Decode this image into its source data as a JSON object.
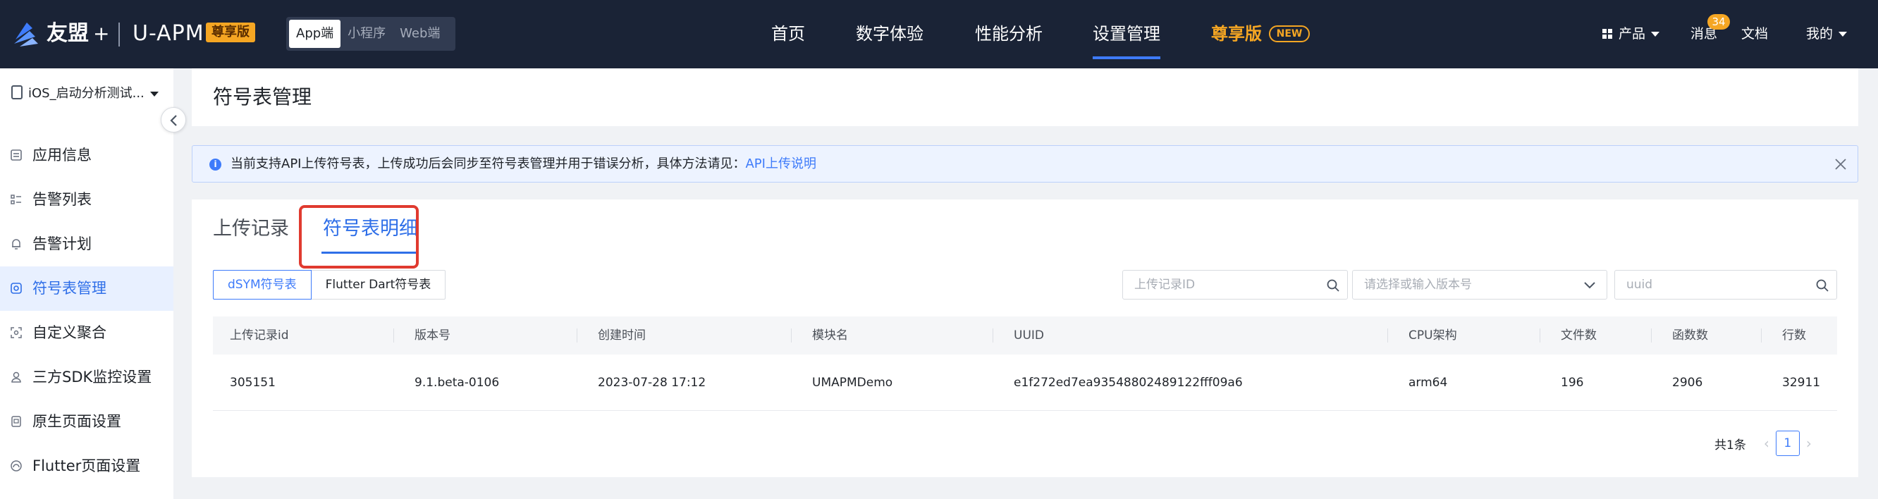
{
  "brand": {
    "name": "友盟",
    "plus": "+",
    "product": "U-APM",
    "edition_badge": "尊享版"
  },
  "platforms": [
    {
      "label": "App端",
      "active": true
    },
    {
      "label": "小程序",
      "active": false
    },
    {
      "label": "Web端",
      "active": false
    }
  ],
  "nav": {
    "items": [
      "首页",
      "数字体验",
      "性能分析",
      "设置管理"
    ],
    "active": "设置管理",
    "vip": "尊享版",
    "new_tag": "NEW"
  },
  "top_right": {
    "products": "产品",
    "messages": "消息",
    "message_count": "34",
    "docs": "文档",
    "mine": "我的"
  },
  "sidebar": {
    "app_name": "iOS_启动分析测试...",
    "items": [
      {
        "label": "应用信息",
        "icon": "file-list-icon"
      },
      {
        "label": "告警列表",
        "icon": "list-icon"
      },
      {
        "label": "告警计划",
        "icon": "bell-icon"
      },
      {
        "label": "符号表管理",
        "icon": "target-icon",
        "active": true
      },
      {
        "label": "自定义聚合",
        "icon": "merge-icon"
      },
      {
        "label": "三方SDK监控设置",
        "icon": "user-icon"
      },
      {
        "label": "原生页面设置",
        "icon": "page-icon"
      },
      {
        "label": "Flutter页面设置",
        "icon": "flutter-icon"
      }
    ]
  },
  "page": {
    "title": "符号表管理"
  },
  "notice": {
    "text": "当前支持API上传符号表，上传成功后会同步至符号表管理并用于错误分析，具体方法请见：",
    "link": "API上传说明"
  },
  "tabs": {
    "upload_records": "上传记录",
    "symbol_details": "符号表明细"
  },
  "segments": {
    "dsym": "dSYM符号表",
    "flutter": "Flutter Dart符号表"
  },
  "filters": {
    "upload_id_placeholder": "上传记录ID",
    "version_placeholder": "请选择或输入版本号",
    "uuid_placeholder": "uuid"
  },
  "table": {
    "headers": [
      "上传记录id",
      "版本号",
      "创建时间",
      "模块名",
      "UUID",
      "CPU架构",
      "文件数",
      "函数数",
      "行数"
    ],
    "rows": [
      [
        "305151",
        "9.1.beta-0106",
        "2023-07-28 17:12",
        "UMAPMDemo",
        "e1f272ed7ea93548802489122fff09a6",
        "arm64",
        "196",
        "2906",
        "32911"
      ]
    ]
  },
  "pagination": {
    "total": "共1条",
    "current": "1"
  },
  "colors": {
    "nav_bg": "#1a2336",
    "accent": "#2f6fe8",
    "vip": "#f5a623",
    "highlight": "#e03a2f"
  }
}
